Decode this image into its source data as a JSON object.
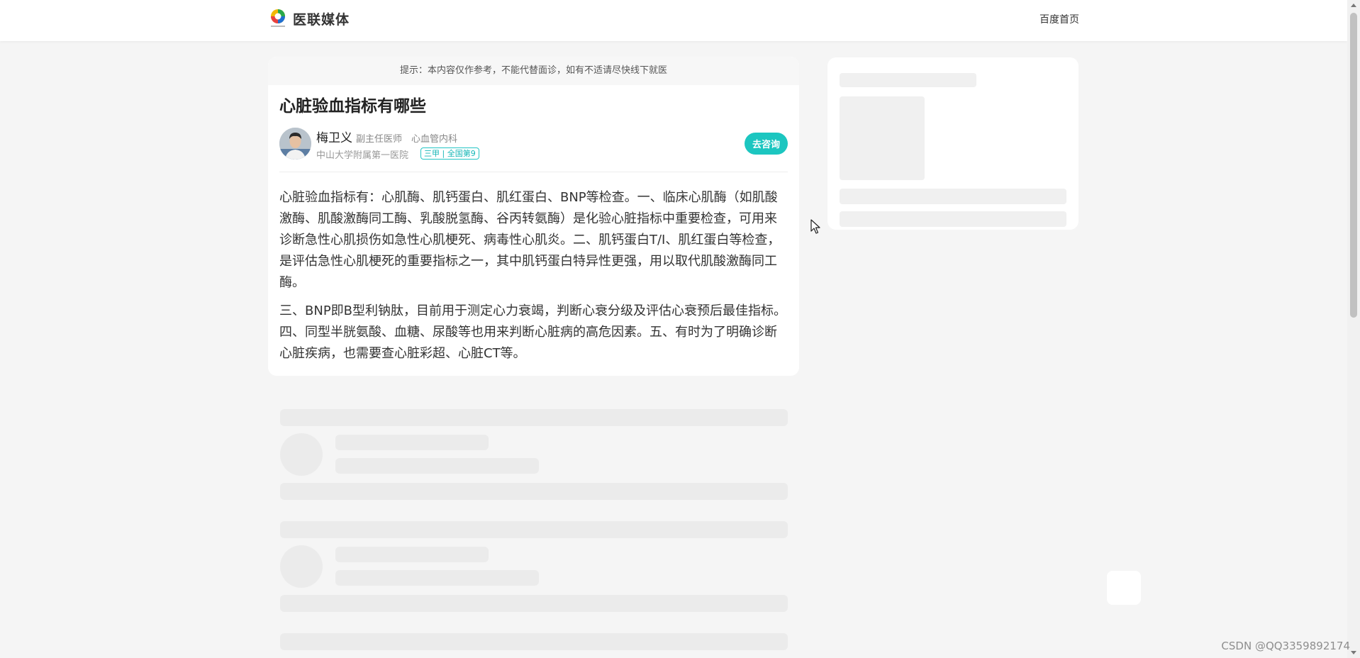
{
  "header": {
    "site_name": "医联媒体",
    "home_link": "百度首页"
  },
  "article": {
    "tip": "提示：本内容仅作参考，不能代替面诊，如有不适请尽快线下就医",
    "title": "心脏验血指标有哪些",
    "doctor": {
      "name": "梅卫义",
      "title": "副主任医师",
      "department": "心血管内科",
      "hospital": "中山大学附属第一医院",
      "badge": "三甲 | 全国第9"
    },
    "consult_label": "去咨询",
    "paragraphs": [
      "心脏验血指标有：心肌酶、肌钙蛋白、肌红蛋白、BNP等检查。一、临床心肌酶（如肌酸激酶、肌酸激酶同工酶、乳酸脱氢酶、谷丙转氨酶）是化验心脏指标中重要检查，可用来诊断急性心肌损伤如急性心肌梗死、病毒性心肌炎。二、肌钙蛋白T/I、肌红蛋白等检查，是评估急性心肌梗死的重要指标之一，其中肌钙蛋白特异性更强，用以取代肌酸激酶同工酶。",
      "三、BNP即B型利钠肽，目前用于测定心力衰竭，判断心衰分级及评估心衰预后最佳指标。四、同型半胱氨酸、血糖、尿酸等也用来判断心脏病的高危因素。五、有时为了明确诊断心脏疾病，也需要查心脏彩超、心脏CT等。"
    ]
  },
  "watermark": "CSDN @QQ3359892174",
  "colors": {
    "accent": "#1cc6c0",
    "background": "#f5f5f5",
    "skeleton": "#ebebeb"
  }
}
